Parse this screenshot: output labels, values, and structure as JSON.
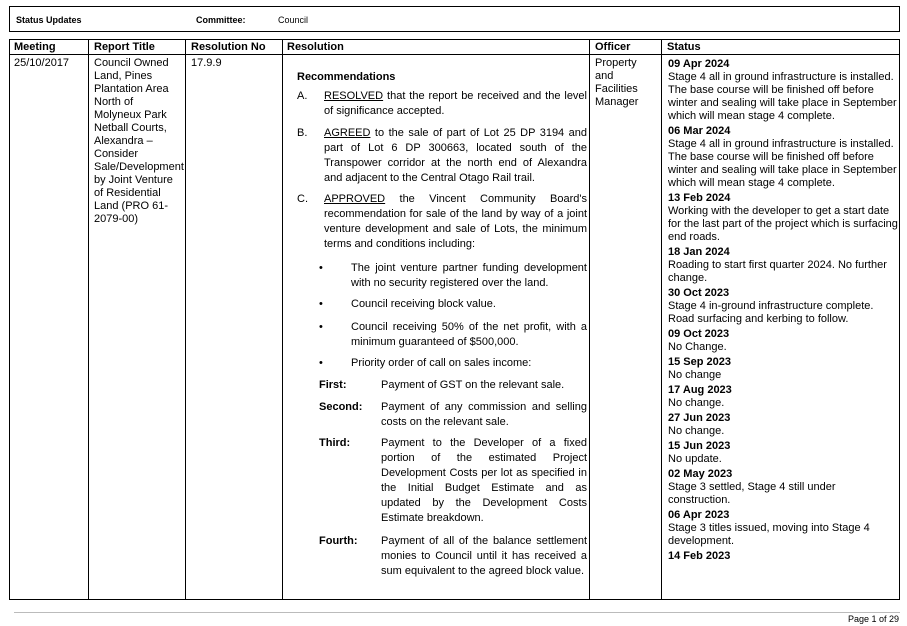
{
  "header": {
    "status_label": "Status Updates",
    "committee_label": "Committee:",
    "committee_value": "Council"
  },
  "columns": {
    "meeting": "Meeting",
    "report_title": "Report Title",
    "resolution_no": "Resolution No",
    "resolution": "Resolution",
    "officer": "Officer",
    "status": "Status"
  },
  "row": {
    "meeting": "25/10/2017",
    "report_title": "Council Owned Land, Pines Plantation Area North of Molyneux Park Netball Courts, Alexandra – Consider Sale/Development by Joint Venture of Residential Land (PRO 61-2079-00)",
    "resolution_no": "17.9.9",
    "officer": "Property and Facilities Manager"
  },
  "resolution": {
    "title": "Recommendations",
    "items": [
      {
        "marker": "A.",
        "keyword": "RESOLVED",
        "text": " that the report be received and the level of significance accepted."
      },
      {
        "marker": "B.",
        "keyword": "AGREED",
        "text": " to the sale of part of Lot 25 DP 3194 and part of Lot 6 DP 300663, located south of the Transpower corridor at the north end of Alexandra and adjacent to the Central Otago Rail trail."
      },
      {
        "marker": "C.",
        "keyword": "APPROVED",
        "text": " the Vincent Community Board's recommendation for sale of the land by way of a joint venture development and sale of Lots, the minimum terms and conditions including:"
      }
    ],
    "bullets": [
      "The joint venture partner funding development with no security registered over the land.",
      "Council receiving block value.",
      "Council receiving 50% of the net profit, with a minimum guaranteed of $500,000.",
      "Priority order of call on sales income:"
    ],
    "priorities": [
      {
        "label": "First:",
        "text": "Payment of GST on the relevant sale."
      },
      {
        "label": "Second:",
        "text": "Payment of any commission and selling costs on the relevant sale."
      },
      {
        "label": "Third:",
        "text": "Payment to the Developer of a fixed portion of the estimated Project Development Costs per lot as specified in the Initial Budget Estimate and as updated by the Development Costs Estimate breakdown."
      },
      {
        "label": "Fourth:",
        "text": "Payment of all of the balance settlement monies to Council until it has received a sum equivalent to the agreed block value."
      }
    ]
  },
  "status_updates": [
    {
      "date": "09 Apr 2024",
      "text": "Stage 4 all in ground infrastructure is installed. The base course will be finished off before winter and sealing will take place in September which will mean stage 4 complete."
    },
    {
      "date": "06 Mar 2024",
      "text": "Stage 4 all in ground infrastructure is installed. The base course will be finished off before winter and sealing will take place in September which will mean stage 4 complete."
    },
    {
      "date": "13 Feb 2024",
      "text": "Working with the developer to get a start date for the last part of the project which is surfacing end roads."
    },
    {
      "date": "18 Jan 2024",
      "text": "Roading to start first quarter 2024. No further change."
    },
    {
      "date": "30 Oct 2023",
      "text": "Stage 4 in-ground infrastructure complete. Road surfacing and kerbing to follow."
    },
    {
      "date": "09 Oct 2023",
      "text": "No Change."
    },
    {
      "date": "15 Sep 2023",
      "text": "No change"
    },
    {
      "date": "17 Aug 2023",
      "text": "No change."
    },
    {
      "date": "27 Jun 2023",
      "text": "No change."
    },
    {
      "date": "15 Jun 2023",
      "text": "No update."
    },
    {
      "date": "02 May 2023",
      "text": "Stage 3 settled, Stage 4 still under construction."
    },
    {
      "date": "06 Apr 2023",
      "text": "Stage 3 titles issued, moving into Stage 4 development."
    },
    {
      "date": "14 Feb 2023",
      "text": ""
    }
  ],
  "footer": {
    "page": "Page 1 of 29"
  }
}
